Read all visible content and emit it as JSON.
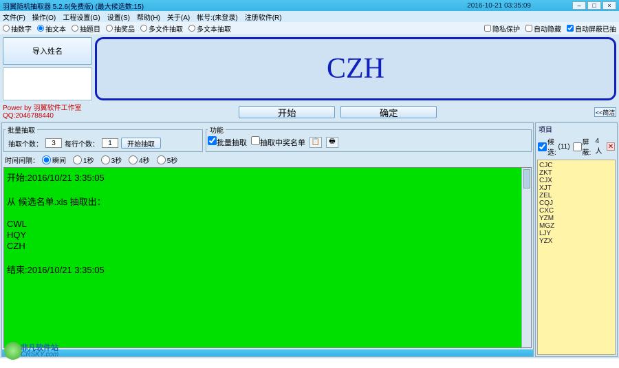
{
  "titlebar": {
    "title": "羽翼随机抽取器 5.2.6(免费版) (最大候选数:15)",
    "datetime": "2016-10-21 03:35:09"
  },
  "menu": {
    "file": "文件(F)",
    "op": "操作(O)",
    "proj": "工程设置(G)",
    "set": "设置(S)",
    "help": "帮助(H)",
    "about": "关于(A)",
    "acct": "帐号:(未登录)",
    "reg": "注册软件(R)"
  },
  "modes": {
    "num": "抽数字",
    "text": "抽文本",
    "topic": "抽题目",
    "prize": "抽奖品",
    "multi": "多文件抽取",
    "multitext": "多文本抽取"
  },
  "flags": {
    "privacy": "隐私保护",
    "autohide": "自动隐藏",
    "autoshield": "自动屏蔽已抽"
  },
  "btn": {
    "import": "导入姓名",
    "start": "开始",
    "ok": "确定",
    "collapse": "<<简洁",
    "startbatch": "开始抽取"
  },
  "display": "CZH",
  "power": {
    "line1": "Power by 羽翼软件工作室",
    "line2": "QQ:2046788440"
  },
  "batch": {
    "group": "批量抽取",
    "countlbl": "抽取个数：",
    "count": "3",
    "perlbl": "每行个数：",
    "per": "1",
    "func": "功能",
    "batchchk": "批量抽取",
    "winnerchk": "抽取中奖名单",
    "intervallbl": "时间间隔：",
    "instant": "瞬间",
    "s1": "1秒",
    "s3": "3秒",
    "s4": "4秒",
    "s5": "5秒"
  },
  "log": "开始:2016/10/21 3:35:05\n\n从 候选名单.xls 抽取出：\n\nCWL\nHQY\nCZH\n\n结束:2016/10/21 3:35:05",
  "proj": {
    "group": "项目",
    "candlbl": "候选:",
    "candnum": "(11)",
    "shieldlbl": "屏蔽:",
    "shieldnum": "4人",
    "items": [
      "CJC",
      "ZKT",
      "CJX",
      "XJT",
      "ZEL",
      "CQJ",
      "CXC",
      "YZM",
      "MGZ",
      "LJY",
      "YZX"
    ]
  },
  "wm": {
    "name": "非凡软件站",
    "url": "CRSKY.com"
  }
}
